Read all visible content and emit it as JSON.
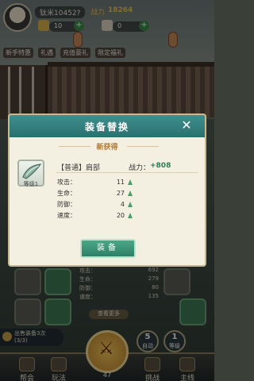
{
  "hud": {
    "player_name": "钛米10452?",
    "power_label": "战力",
    "power_value": "18264",
    "resource_1": "10",
    "resource_2": "0",
    "menu": [
      "新手特惠",
      "礼遇",
      "充值豪礼",
      "限定福礼"
    ]
  },
  "dialog": {
    "title": "装备替换",
    "close_icon": "close-icon",
    "new_tag": "新获得",
    "item": {
      "icon": "shoulder-armor-icon",
      "level": "等级1",
      "name": "【普通】肩部",
      "power_label": "战力：",
      "power_delta": "+808",
      "stats": [
        {
          "label": "攻击：",
          "value": "11"
        },
        {
          "label": "生命：",
          "value": "27"
        },
        {
          "label": "防御：",
          "value": "4"
        },
        {
          "label": "速度：",
          "value": "20"
        }
      ]
    },
    "equip_button": "装备"
  },
  "panel": {
    "stats": [
      {
        "label": "攻击：",
        "value": "692"
      },
      {
        "label": "生命：",
        "value": "279"
      },
      {
        "label": "防御：",
        "value": "80"
      },
      {
        "label": "速度：",
        "value": "135"
      }
    ],
    "more_button": "查看更多",
    "sell_tip_line1": "出售装备3次",
    "sell_tip_line2": "(3/3)"
  },
  "badges": {
    "auto_num": "5",
    "auto_label": "自动",
    "level_num": "1",
    "level_label": "等级"
  },
  "bottom_nav": {
    "items": [
      {
        "label": "帮会",
        "icon": "guild-icon"
      },
      {
        "label": "玩法",
        "icon": "gameplay-icon"
      },
      {
        "label": "挑战",
        "icon": "challenge-icon"
      },
      {
        "label": "主线",
        "icon": "main-quest-icon"
      }
    ],
    "center_count": "47",
    "center_icon": "crossed-swords-icon"
  },
  "colors": {
    "header_teal": "#2c6f70",
    "equip_green": "#2f8066",
    "power_gold": "#f0c84a",
    "stat_up": "#4aa06a"
  }
}
